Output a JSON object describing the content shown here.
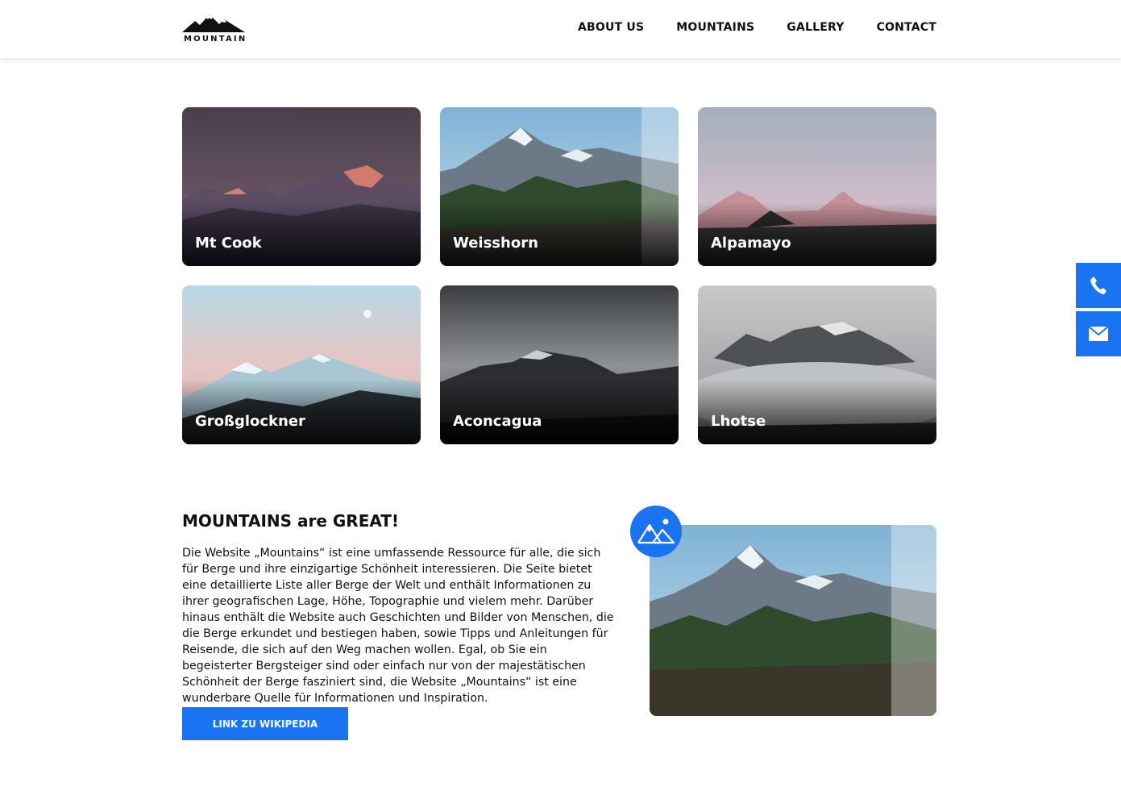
{
  "header": {
    "logo_text": "MOUNTAIN",
    "nav": [
      "ABOUT US",
      "MOUNTAINS",
      "GALLERY",
      "CONTACT"
    ]
  },
  "cards": [
    {
      "name": "Mt Cook"
    },
    {
      "name": "Weisshorn"
    },
    {
      "name": "Alpamayo"
    },
    {
      "name": "Großglockner"
    },
    {
      "name": "Aconcagua"
    },
    {
      "name": "Lhotse"
    }
  ],
  "about": {
    "headline": "MOUNTAINS are GREAT!",
    "text": "Die Website „Mountains“ ist eine umfassende Ressource für alle, die sich für Berge und ihre einzigartige Schönheit interessieren. Die Seite bietet eine detaillierte Liste aller Berge der Welt und enthält Informationen zu ihrer geografischen Lage, Höhe, Topographie und vielem mehr. Darüber hinaus enthält die Website auch Geschichten und Bilder von Menschen, die die Berge erkundet und bestiegen haben, sowie Tipps und Anleitungen für Reisende, die sich auf den Weg machen wollen. Egal, ob Sie ein begeisterter Bergsteiger sind oder einfach nur von der majestätischen Schönheit der Berge fasziniert sind, die Website „Mountains“ ist eine wunderbare Quelle für Informationen und Inspiration.",
    "button_label": "LINK ZU WIKIPEDIA"
  },
  "side_buttons": {
    "phone_icon": "phone-icon",
    "mail_icon": "mail-icon"
  },
  "colors": {
    "accent": "#1a73f0"
  }
}
